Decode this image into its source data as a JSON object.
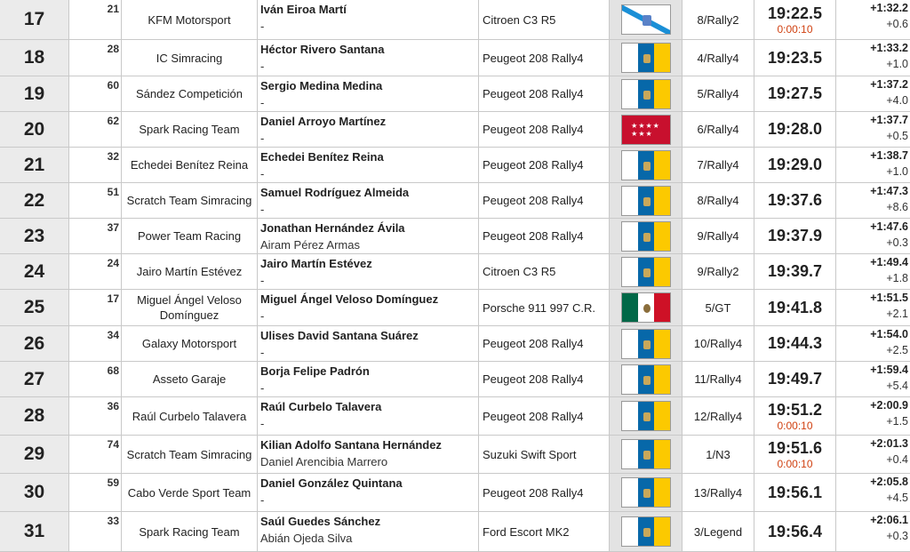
{
  "colors": {
    "position_bg": "#ebebeb",
    "flag_cell_bg": "#e3e3e3",
    "penalty": "#d04010",
    "border": "#c9c9c9"
  },
  "rows": [
    {
      "pos": "17",
      "num": "21",
      "team": "KFM Motorsport",
      "driver": "Iván Eiroa Martí",
      "codriver": "-",
      "car": "Citroen C3 R5",
      "flag": "galicia-flag",
      "class": "8/Rally2",
      "time": "19:22.5",
      "penalty": "0:00:10",
      "gap1": "+1:32.2",
      "gap2": "+0.6"
    },
    {
      "pos": "18",
      "num": "28",
      "team": "IC Simracing",
      "driver": "Héctor Rivero Santana",
      "codriver": "-",
      "car": "Peugeot 208 Rally4",
      "flag": "canarias-flag",
      "class": "4/Rally4",
      "time": "19:23.5",
      "penalty": "",
      "gap1": "+1:33.2",
      "gap2": "+1.0"
    },
    {
      "pos": "19",
      "num": "60",
      "team": "Sández Competición",
      "driver": "Sergio Medina Medina",
      "codriver": "-",
      "car": "Peugeot 208 Rally4",
      "flag": "canarias-flag",
      "class": "5/Rally4",
      "time": "19:27.5",
      "penalty": "",
      "gap1": "+1:37.2",
      "gap2": "+4.0"
    },
    {
      "pos": "20",
      "num": "62",
      "team": "Spark Racing Team",
      "driver": "Daniel Arroyo Martínez",
      "codriver": "-",
      "car": "Peugeot 208 Rally4",
      "flag": "madrid-flag",
      "class": "6/Rally4",
      "time": "19:28.0",
      "penalty": "",
      "gap1": "+1:37.7",
      "gap2": "+0.5"
    },
    {
      "pos": "21",
      "num": "32",
      "team": "Echedei Benítez Reina",
      "driver": "Echedei Benítez Reina",
      "codriver": "-",
      "car": "Peugeot 208 Rally4",
      "flag": "canarias-flag",
      "class": "7/Rally4",
      "time": "19:29.0",
      "penalty": "",
      "gap1": "+1:38.7",
      "gap2": "+1.0"
    },
    {
      "pos": "22",
      "num": "51",
      "team": "Scratch Team Simracing",
      "driver": "Samuel Rodríguez Almeida",
      "codriver": "-",
      "car": "Peugeot 208 Rally4",
      "flag": "canarias-flag",
      "class": "8/Rally4",
      "time": "19:37.6",
      "penalty": "",
      "gap1": "+1:47.3",
      "gap2": "+8.6"
    },
    {
      "pos": "23",
      "num": "37",
      "team": "Power Team Racing",
      "driver": "Jonathan Hernández Ávila",
      "codriver": "Airam Pérez Armas",
      "car": "Peugeot 208 Rally4",
      "flag": "canarias-flag",
      "class": "9/Rally4",
      "time": "19:37.9",
      "penalty": "",
      "gap1": "+1:47.6",
      "gap2": "+0.3"
    },
    {
      "pos": "24",
      "num": "24",
      "team": "Jairo Martín Estévez",
      "driver": "Jairo Martín Estévez",
      "codriver": "-",
      "car": "Citroen C3 R5",
      "flag": "canarias-flag",
      "class": "9/Rally2",
      "time": "19:39.7",
      "penalty": "",
      "gap1": "+1:49.4",
      "gap2": "+1.8"
    },
    {
      "pos": "25",
      "num": "17",
      "team": "Miguel Ángel Veloso Domínguez",
      "driver": "Miguel Ángel Veloso Domínguez",
      "codriver": "-",
      "car": "Porsche 911 997 C.R.",
      "flag": "mexico-flag",
      "class": "5/GT",
      "time": "19:41.8",
      "penalty": "",
      "gap1": "+1:51.5",
      "gap2": "+2.1"
    },
    {
      "pos": "26",
      "num": "34",
      "team": "Galaxy Motorsport",
      "driver": "Ulises David Santana Suárez",
      "codriver": "-",
      "car": "Peugeot 208 Rally4",
      "flag": "canarias-flag",
      "class": "10/Rally4",
      "time": "19:44.3",
      "penalty": "",
      "gap1": "+1:54.0",
      "gap2": "+2.5"
    },
    {
      "pos": "27",
      "num": "68",
      "team": "Asseto Garaje",
      "driver": "Borja Felipe Padrón",
      "codriver": "-",
      "car": "Peugeot 208 Rally4",
      "flag": "canarias-flag",
      "class": "11/Rally4",
      "time": "19:49.7",
      "penalty": "",
      "gap1": "+1:59.4",
      "gap2": "+5.4"
    },
    {
      "pos": "28",
      "num": "36",
      "team": "Raúl Curbelo Talavera",
      "driver": "Raúl Curbelo Talavera",
      "codriver": "-",
      "car": "Peugeot 208 Rally4",
      "flag": "canarias-flag",
      "class": "12/Rally4",
      "time": "19:51.2",
      "penalty": "0:00:10",
      "gap1": "+2:00.9",
      "gap2": "+1.5"
    },
    {
      "pos": "29",
      "num": "74",
      "team": "Scratch Team Simracing",
      "driver": "Kilian Adolfo Santana Hernández",
      "codriver": "Daniel Arencibia Marrero",
      "car": "Suzuki Swift Sport",
      "flag": "canarias-flag",
      "class": "1/N3",
      "time": "19:51.6",
      "penalty": "0:00:10",
      "gap1": "+2:01.3",
      "gap2": "+0.4"
    },
    {
      "pos": "30",
      "num": "59",
      "team": "Cabo Verde Sport Team",
      "driver": "Daniel González Quintana",
      "codriver": "-",
      "car": "Peugeot 208 Rally4",
      "flag": "canarias-flag",
      "class": "13/Rally4",
      "time": "19:56.1",
      "penalty": "",
      "gap1": "+2:05.8",
      "gap2": "+4.5"
    },
    {
      "pos": "31",
      "num": "33",
      "team": "Spark Racing Team",
      "driver": "Saúl Guedes Sánchez",
      "codriver": "Abián Ojeda Silva",
      "car": "Ford Escort MK2",
      "flag": "canarias-flag",
      "class": "3/Legend",
      "time": "19:56.4",
      "penalty": "",
      "gap1": "+2:06.1",
      "gap2": "+0.3"
    }
  ]
}
